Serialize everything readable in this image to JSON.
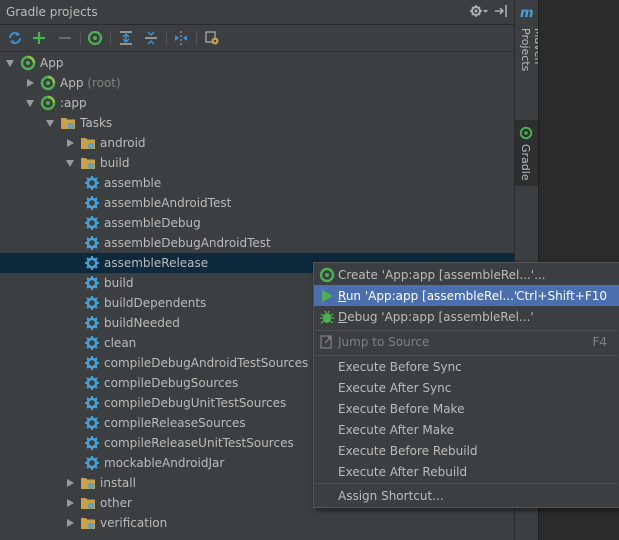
{
  "panel": {
    "title": "Gradle projects"
  },
  "tree": [
    {
      "label": "App",
      "suffix": ""
    },
    {
      "label": "App",
      "suffix": "(root)"
    },
    {
      "label": ":app",
      "suffix": ""
    },
    {
      "label": "Tasks",
      "suffix": ""
    },
    {
      "label": "android",
      "suffix": ""
    },
    {
      "label": "build",
      "suffix": ""
    },
    {
      "label": "assemble",
      "suffix": ""
    },
    {
      "label": "assembleAndroidTest",
      "suffix": ""
    },
    {
      "label": "assembleDebug",
      "suffix": ""
    },
    {
      "label": "assembleDebugAndroidTest",
      "suffix": ""
    },
    {
      "label": "assembleRelease",
      "suffix": ""
    },
    {
      "label": "build",
      "suffix": ""
    },
    {
      "label": "buildDependents",
      "suffix": ""
    },
    {
      "label": "buildNeeded",
      "suffix": ""
    },
    {
      "label": "clean",
      "suffix": ""
    },
    {
      "label": "compileDebugAndroidTestSources",
      "suffix": ""
    },
    {
      "label": "compileDebugSources",
      "suffix": ""
    },
    {
      "label": "compileDebugUnitTestSources",
      "suffix": ""
    },
    {
      "label": "compileReleaseSources",
      "suffix": ""
    },
    {
      "label": "compileReleaseUnitTestSources",
      "suffix": ""
    },
    {
      "label": "mockableAndroidJar",
      "suffix": ""
    },
    {
      "label": "install",
      "suffix": ""
    },
    {
      "label": "other",
      "suffix": ""
    },
    {
      "label": "verification",
      "suffix": ""
    }
  ],
  "side_tabs": {
    "maven_logo": "m",
    "maven": "Maven Projects",
    "gradle": "Gradle"
  },
  "menu": [
    {
      "label": "Create 'App:app [assembleRel...'...",
      "shortcut": ""
    },
    {
      "label": "Run 'App:app [assembleRel...'",
      "shortcut": "Ctrl+Shift+F10"
    },
    {
      "label": "Debug 'App:app [assembleRel...'",
      "shortcut": ""
    },
    {
      "label": "Jump to Source",
      "shortcut": "F4"
    },
    {
      "label": "Execute Before Sync",
      "shortcut": ""
    },
    {
      "label": "Execute After Sync",
      "shortcut": ""
    },
    {
      "label": "Execute Before Make",
      "shortcut": ""
    },
    {
      "label": "Execute After Make",
      "shortcut": ""
    },
    {
      "label": "Execute Before Rebuild",
      "shortcut": ""
    },
    {
      "label": "Execute After Rebuild",
      "shortcut": ""
    },
    {
      "label": "Assign Shortcut...",
      "shortcut": ""
    }
  ],
  "colors": {
    "background": "#3c3f41",
    "selection": "#0d293e",
    "menu_highlight": "#4b6eaf",
    "gradle_green": "#4caf50",
    "gear_blue": "#4a9fd6",
    "folder": "#c9a04a"
  }
}
